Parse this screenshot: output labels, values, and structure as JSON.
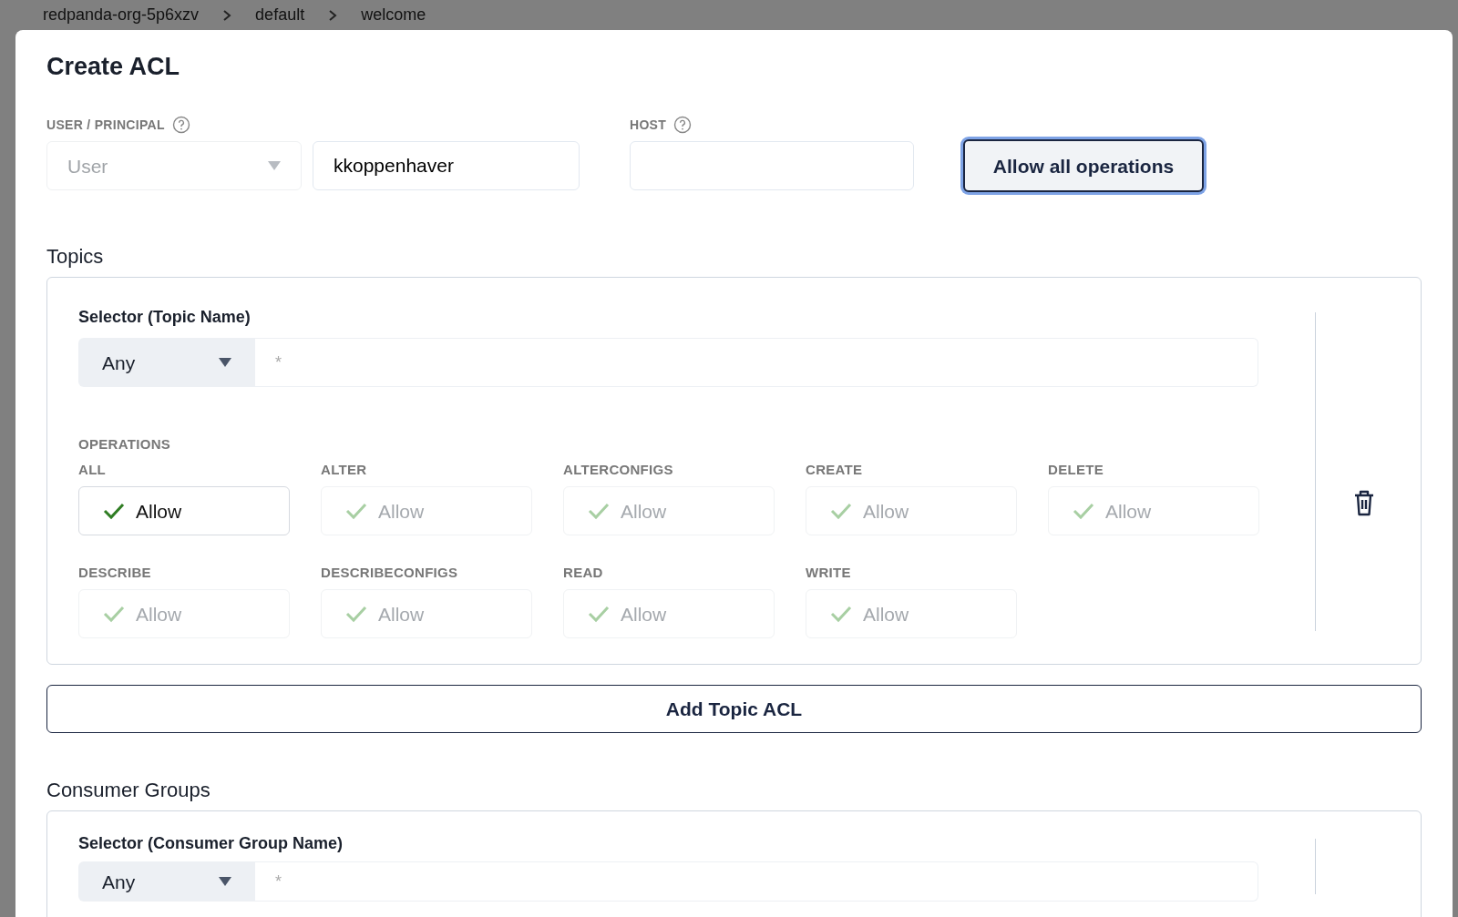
{
  "breadcrumb": [
    "redpanda-org-5p6xzv",
    "default",
    "welcome"
  ],
  "modal": {
    "title": "Create ACL",
    "principal": {
      "label": "USER / PRINCIPAL",
      "type_value": "User",
      "type_disabled": true,
      "name_value": "kkoppenhaver"
    },
    "host": {
      "label": "HOST"
    },
    "allow_all_button": {
      "label": "Allow all operations",
      "focused": true
    },
    "sections": [
      {
        "title": "Topics",
        "selector_label": "Selector (Topic Name)",
        "match": "Any",
        "placeholder": "*",
        "operations_label": "OPERATIONS",
        "operations": [
          {
            "name": "ALL",
            "value": "Allow",
            "disabled": false
          },
          {
            "name": "ALTER",
            "value": "Allow",
            "disabled": true
          },
          {
            "name": "ALTERCONFIGS",
            "value": "Allow",
            "disabled": true
          },
          {
            "name": "CREATE",
            "value": "Allow",
            "disabled": true
          },
          {
            "name": "DELETE",
            "value": "Allow",
            "disabled": true
          },
          {
            "name": "DESCRIBE",
            "value": "Allow",
            "disabled": true
          },
          {
            "name": "DESCRIBECONFIGS",
            "value": "Allow",
            "disabled": true
          },
          {
            "name": "READ",
            "value": "Allow",
            "disabled": true
          },
          {
            "name": "WRITE",
            "value": "Allow",
            "disabled": true
          }
        ],
        "add_button": "Add Topic ACL"
      },
      {
        "title": "Consumer Groups",
        "selector_label": "Selector (Consumer Group Name)",
        "match": "Any",
        "placeholder": "*"
      }
    ]
  }
}
